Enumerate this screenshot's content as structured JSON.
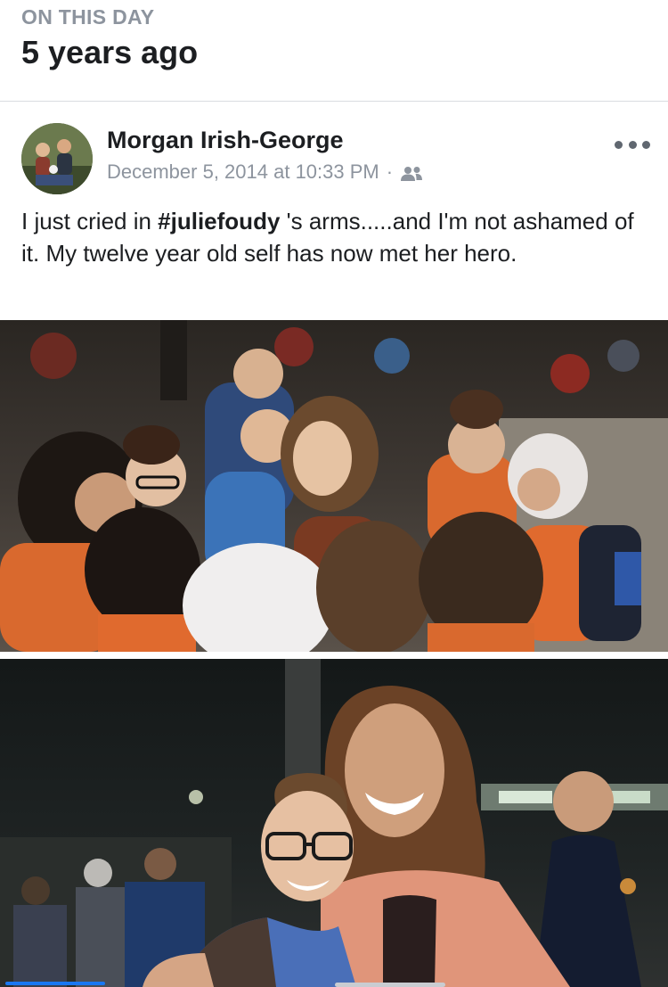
{
  "memories": {
    "kicker": "ON THIS DAY",
    "title": "5 years ago"
  },
  "post": {
    "author": "Morgan Irish-George",
    "timestamp": "December 5, 2014 at 10:33 PM",
    "meta_separator": "·",
    "audience_icon": "friends-icon",
    "text_before": "I just cried in ",
    "hashtag": "#juliefoudy",
    "text_after": " 's arms.....and I'm not ashamed of it. My twelve year old self has now met her hero.",
    "photos": [
      {
        "icon": "photo"
      },
      {
        "icon": "photo"
      }
    ]
  },
  "colors": {
    "accent": "#1877f2",
    "secondary_text": "#8d949e",
    "primary_text": "#1c1e21"
  }
}
